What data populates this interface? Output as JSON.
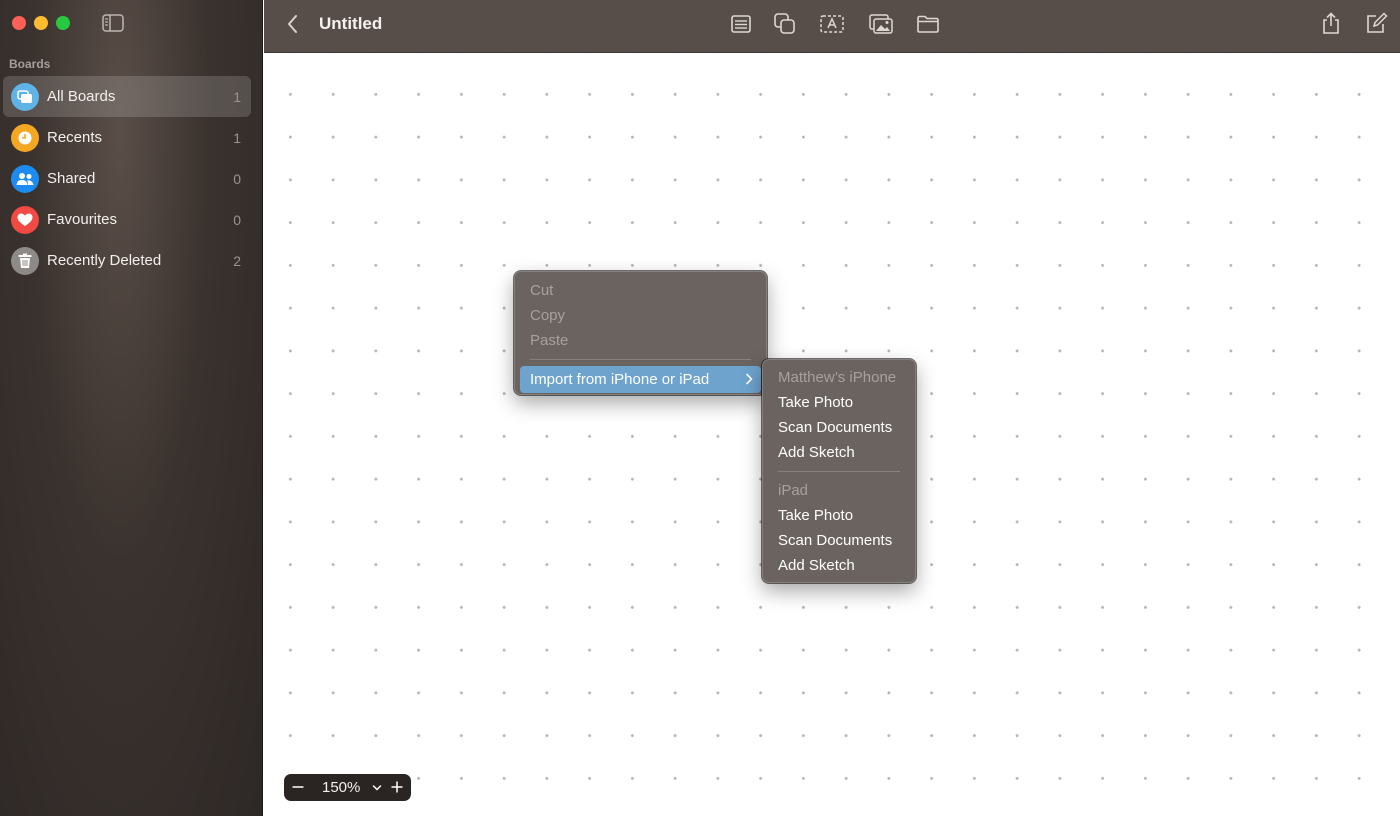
{
  "sidebar": {
    "section_label": "Boards",
    "items": [
      {
        "label": "All Boards",
        "count": "1",
        "icon": "boards-icon",
        "color": "#5fb3e6"
      },
      {
        "label": "Recents",
        "count": "1",
        "icon": "clock-icon",
        "color": "#f5a623"
      },
      {
        "label": "Shared",
        "count": "0",
        "icon": "people-icon",
        "color": "#1d8cf0"
      },
      {
        "label": "Favourites",
        "count": "0",
        "icon": "heart-icon",
        "color": "#f04a43"
      },
      {
        "label": "Recently Deleted",
        "count": "2",
        "icon": "trash-icon",
        "color": "#8e8a88"
      }
    ]
  },
  "toolbar": {
    "title": "Untitled",
    "tools": [
      "note-icon",
      "shapes-icon",
      "textbox-icon",
      "media-icon",
      "folder-icon"
    ],
    "right_tools": [
      "share-icon",
      "compose-icon"
    ]
  },
  "context_menu": {
    "items": [
      "Cut",
      "Copy",
      "Paste"
    ],
    "import_label": "Import from iPhone or iPad"
  },
  "submenu": {
    "iphone_header": "Matthew’s iPhone",
    "iphone_items": [
      "Take Photo",
      "Scan Documents",
      "Add Sketch"
    ],
    "ipad_header": "iPad",
    "ipad_items": [
      "Take Photo",
      "Scan Documents",
      "Add Sketch"
    ]
  },
  "zoom": {
    "value": "150%"
  },
  "colors": {
    "accent_highlight": "#6da3cd",
    "toolbar_bg": "#584e49",
    "menu_bg": "#6b6360"
  }
}
